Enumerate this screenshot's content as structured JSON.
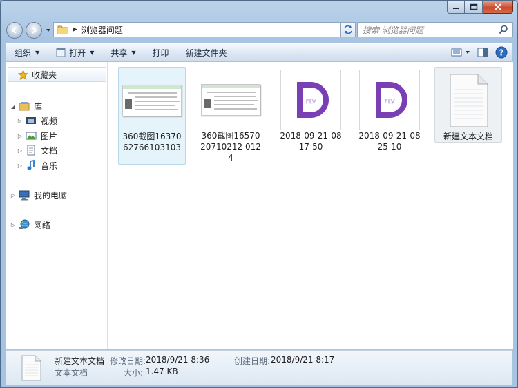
{
  "window": {
    "caption": {
      "minimize": "minimize",
      "maximize": "maximize",
      "close": "close"
    }
  },
  "address": {
    "path": "浏览器问题",
    "search_placeholder": "搜索 浏览器问题"
  },
  "toolbar": {
    "organize": "组织",
    "open": "打开",
    "share": "共享",
    "print": "打印",
    "new_folder": "新建文件夹"
  },
  "sidebar": {
    "favorites": "收藏夹",
    "library": "库",
    "library_items": [
      "视频",
      "图片",
      "文档",
      "音乐"
    ],
    "computer": "我的电脑",
    "network": "网络"
  },
  "files": [
    {
      "name": "360截图1637062766103103",
      "type": "image",
      "icon": "screenshot-thumbnail"
    },
    {
      "name": "360截图1657020710212 0124",
      "type": "image",
      "icon": "screenshot-thumbnail"
    },
    {
      "name": "2018-09-21-0817-50",
      "type": "video",
      "icon": "flv-icon",
      "badge": "FLV"
    },
    {
      "name": "2018-09-21-0825-10",
      "type": "video",
      "icon": "flv-icon",
      "badge": "FLV"
    },
    {
      "name": "新建文本文档",
      "type": "text",
      "icon": "text-document-icon"
    }
  ],
  "details": {
    "name": "新建文本文档",
    "type": "文本文档",
    "modified_label": "修改日期:",
    "modified_value": "2018/9/21 8:36",
    "created_label": "创建日期:",
    "created_value": "2018/9/21 8:17",
    "size_label": "大小:",
    "size_value": "1.47 KB"
  },
  "colors": {
    "selection": "#e5f3fb",
    "flv_purple": "#7b3fb5",
    "chrome_blue": "#a7c3e2"
  }
}
